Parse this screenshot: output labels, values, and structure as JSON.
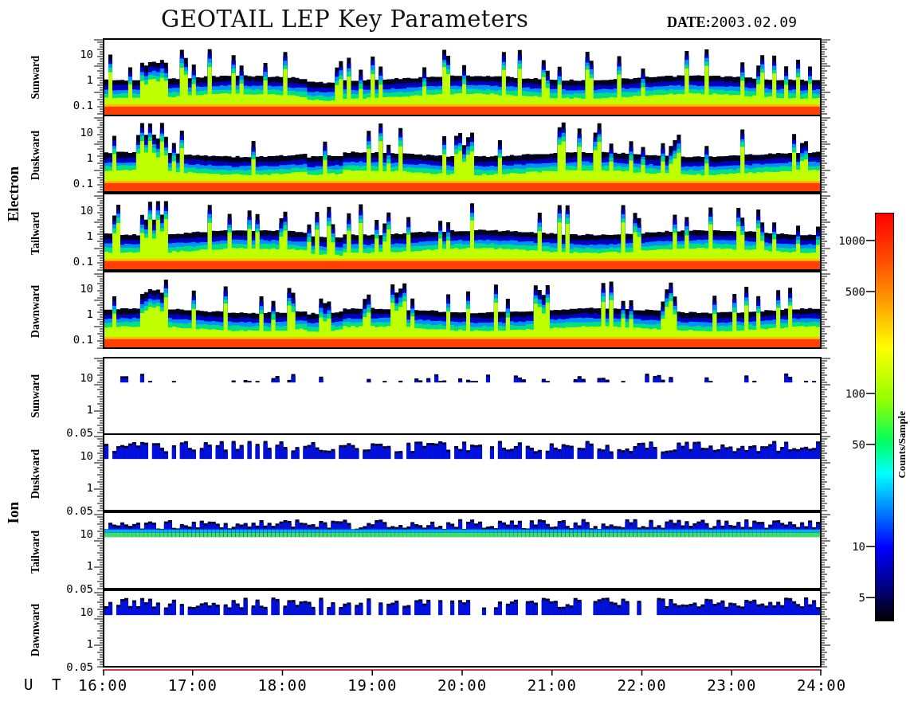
{
  "title": "GEOTAIL LEP Key Parameters",
  "date": {
    "label": "DATE:",
    "value": "2003.02.09"
  },
  "groups": [
    {
      "name": "Electron",
      "kind": "electron",
      "panels": [
        {
          "label": "Sunward",
          "yticks": [
            "10",
            "1",
            "0.1"
          ]
        },
        {
          "label": "Duskward",
          "yticks": [
            "10",
            "1",
            "0.1"
          ]
        },
        {
          "label": "Tailward",
          "yticks": [
            "10",
            "1",
            "0.1"
          ]
        },
        {
          "label": "Dawnward",
          "yticks": [
            "10",
            "1",
            "0.1"
          ]
        }
      ]
    },
    {
      "name": "Ion",
      "kind": "ion",
      "panels": [
        {
          "label": "Sunward",
          "yticks": [
            "10",
            "1",
            "0.05"
          ]
        },
        {
          "label": "Duskward",
          "yticks": [
            "10",
            "1",
            "0.05"
          ]
        },
        {
          "label": "Tailward",
          "yticks": [
            "10",
            "1",
            "0.05"
          ]
        },
        {
          "label": "Dawnward",
          "yticks": [
            "10",
            "1",
            "0.05"
          ]
        }
      ]
    }
  ],
  "colorbar": {
    "label": "Counts/Sample",
    "ticks": [
      "1000",
      "500",
      "100",
      "50",
      "10",
      "5"
    ]
  },
  "time_axis": {
    "label": "U T",
    "ticks": [
      "16:00",
      "17:00",
      "18:00",
      "19:00",
      "20:00",
      "21:00",
      "22:00",
      "23:00",
      "24:00"
    ]
  }
}
